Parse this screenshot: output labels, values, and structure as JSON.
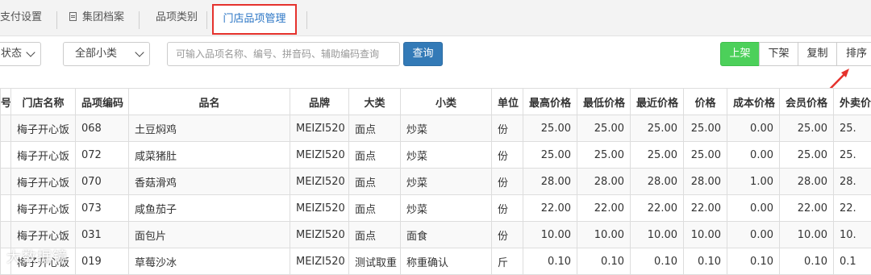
{
  "tabs": [
    {
      "label": "支付设置"
    },
    {
      "label": "集团档案"
    },
    {
      "label": "品项类别"
    },
    {
      "label": "门店品项管理",
      "active": true
    }
  ],
  "filters": {
    "status": "状态",
    "category": "全部小类",
    "search_placeholder": "可输入品项名称、编号、拼音码、辅助编码查询",
    "query_label": "查询"
  },
  "toolbar": {
    "on_shelf": "上架",
    "off_shelf": "下架",
    "copy": "复制",
    "sort": "排序"
  },
  "annotation_color": "#e5322d",
  "table": {
    "headers": [
      "号",
      "门店名称",
      "品项编码",
      "品名",
      "品牌",
      "大类",
      "小类",
      "单位",
      "最高价格",
      "最低价格",
      "最近价格",
      "价格",
      "成本价格",
      "会员价格",
      "外卖价"
    ],
    "rows": [
      [
        "",
        "梅子开心饭",
        "068",
        "土豆焖鸡",
        "MEIZI520",
        "面点",
        "炒菜",
        "份",
        "25.00",
        "25.00",
        "25.00",
        "25.00",
        "0.00",
        "25.00",
        "25."
      ],
      [
        "",
        "梅子开心饭",
        "072",
        "咸菜猪肚",
        "MEIZI520",
        "面点",
        "炒菜",
        "份",
        "25.00",
        "25.00",
        "25.00",
        "25.00",
        "0.00",
        "25.00",
        "25."
      ],
      [
        "",
        "梅子开心饭",
        "070",
        "香菇滑鸡",
        "MEIZI520",
        "面点",
        "炒菜",
        "份",
        "28.00",
        "28.00",
        "28.00",
        "28.00",
        "1.00",
        "28.00",
        "28."
      ],
      [
        "",
        "梅子开心饭",
        "073",
        "咸鱼茄子",
        "MEIZI520",
        "面点",
        "炒菜",
        "份",
        "22.00",
        "22.00",
        "22.00",
        "22.00",
        "0.00",
        "22.00",
        "22."
      ],
      [
        "",
        "梅子开心饭",
        "031",
        "面包片",
        "MEIZI520",
        "面点",
        "面食",
        "份",
        "10.00",
        "10.00",
        "10.00",
        "10.00",
        "0.00",
        "10.00",
        "10."
      ],
      [
        "",
        "梅子开心饭",
        "019",
        "草莓沙冰",
        "MEIZI520",
        "测试取重",
        "称重确认",
        "斤",
        "0.10",
        "0.10",
        "0.10",
        "0.10",
        "0.10",
        "0.10",
        "0.1"
      ]
    ]
  },
  "watermark": "大数据镜"
}
